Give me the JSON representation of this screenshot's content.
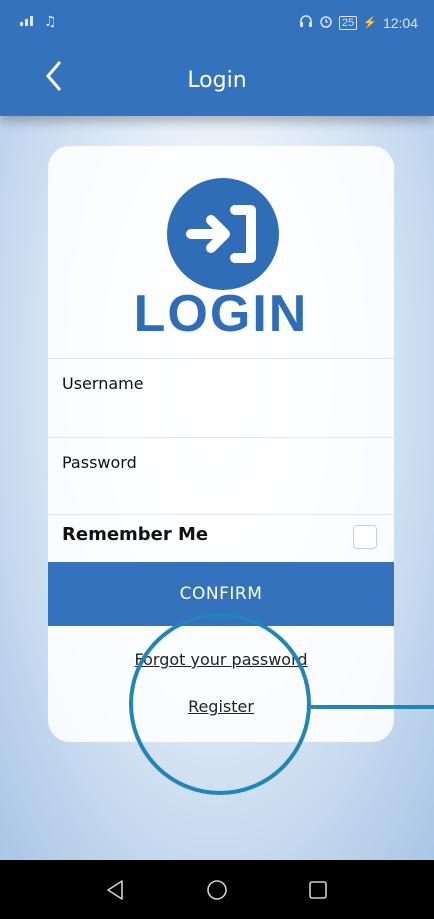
{
  "status_bar": {
    "signal_icon": "signal-icon",
    "music_icon": "music-icon",
    "headphones_icon": "headphones-icon",
    "alarm_icon": "alarm-icon",
    "battery_level": "25",
    "time": "12:04"
  },
  "app_bar": {
    "title": "Login",
    "back_icon": "back-chevron-icon",
    "background_color": "#3472bd"
  },
  "login_card": {
    "logo_icon": "login-arrow-icon",
    "logo_text": "LOGIN",
    "username_label": "Username",
    "password_label": "Password",
    "remember_label": "Remember Me",
    "remember_checked": false,
    "confirm_label": "CONFIRM",
    "forgot_password_link": "Forgot your password",
    "register_link": "Register"
  },
  "annotation": {
    "highlight_color": "#1f86b6"
  },
  "nav_bar": {
    "back": "nav-back-icon",
    "home": "nav-home-icon",
    "recents": "nav-recents-icon"
  }
}
